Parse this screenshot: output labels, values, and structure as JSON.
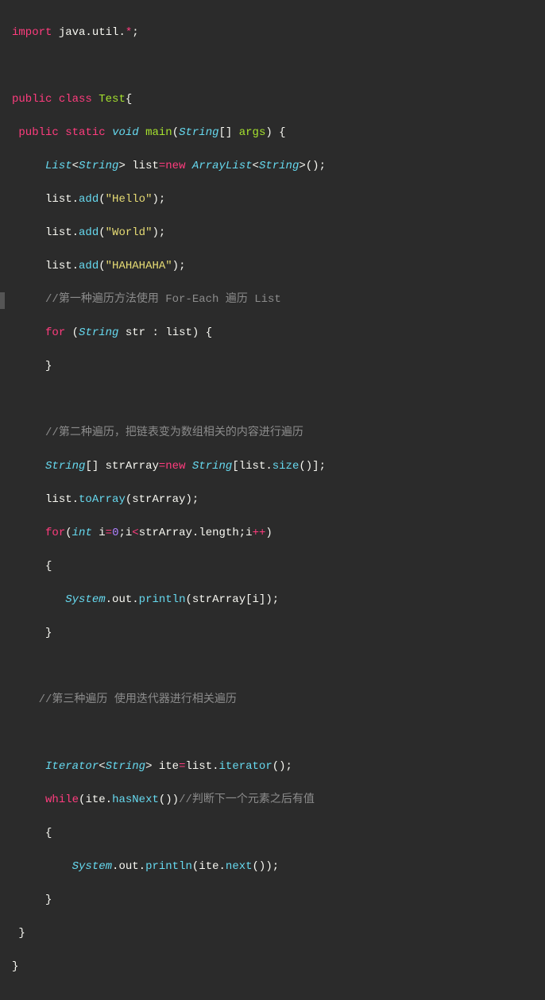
{
  "code": {
    "l1_import": "import",
    "l1_pkg": "java.util.",
    "l1_star": "*",
    "l1_semi": ";",
    "l2_public": "public",
    "l2_class": "class",
    "l2_name": "Test",
    "l2_brace": "{",
    "l3_public": "public",
    "l3_static": "static",
    "l3_void": "void",
    "l3_main": "main",
    "l3_paren1": "(",
    "l3_type": "String",
    "l3_brackets": "[] ",
    "l3_args": "args",
    "l3_paren2": ") {",
    "l4_type": "List",
    "l4_lt": "<",
    "l4_generic": "String",
    "l4_gt": "> ",
    "l4_var": "list",
    "l4_eq": "=",
    "l4_new": "new",
    "l4_arraylist": "ArrayList",
    "l4_lt2": "<",
    "l4_generic2": "String",
    "l4_gt2": ">();",
    "l5_var": "list",
    "l5_dot": ".",
    "l5_add": "add",
    "l5_str": "\"Hello\"",
    "l5_end": ");",
    "l5_paren": "(",
    "l6_var": "list",
    "l6_dot": ".",
    "l6_add": "add",
    "l6_paren": "(",
    "l6_str": "\"World\"",
    "l6_end": ");",
    "l7_var": "list",
    "l7_dot": ".",
    "l7_add": "add",
    "l7_paren": "(",
    "l7_str": "\"HAHAHAHA\"",
    "l7_end": ");",
    "l8_comment": "//第一种遍历方法使用 For-Each 遍历 List",
    "l9_for": "for",
    "l9_paren1": " (",
    "l9_type": "String",
    "l9_var": "str",
    "l9_colon": " : ",
    "l9_list": "list",
    "l9_paren2": ") {",
    "l10_brace": "}",
    "l11_comment": "//第二种遍历，把链表变为数组相关的内容进行遍历",
    "l12_type": "String",
    "l12_brackets": "[] ",
    "l12_var": "strArray",
    "l12_eq": "=",
    "l12_new": "new",
    "l12_type2": "String",
    "l12_bracket1": "[",
    "l12_list": "list",
    "l12_dot": ".",
    "l12_size": "size",
    "l12_end": "()];",
    "l13_var": "list",
    "l13_dot": ".",
    "l13_method": "toArray",
    "l13_paren": "(",
    "l13_arg": "strArray",
    "l13_end": ");",
    "l14_for": "for",
    "l14_paren": "(",
    "l14_int": "int",
    "l14_var": "i",
    "l14_eq": "=",
    "l14_zero": "0",
    "l14_semi1": ";",
    "l14_i": "i",
    "l14_lt": "<",
    "l14_arr": "strArray",
    "l14_dot": ".",
    "l14_length": "length",
    "l14_semi2": ";",
    "l14_i2": "i",
    "l14_inc": "++",
    "l14_paren2": ")",
    "l15_brace": "{",
    "l16_sys": "System",
    "l16_dot1": ".",
    "l16_out": "out",
    "l16_dot2": ".",
    "l16_println": "println",
    "l16_paren": "(",
    "l16_arr": "strArray",
    "l16_bracket1": "[",
    "l16_i": "i",
    "l16_bracket2": "]);",
    "l17_brace": "}",
    "l18_comment": "//第三种遍历 使用迭代器进行相关遍历",
    "l19_type": "Iterator",
    "l19_lt": "<",
    "l19_generic": "String",
    "l19_gt": "> ",
    "l19_var": "ite",
    "l19_eq": "=",
    "l19_list": "list",
    "l19_dot": ".",
    "l19_method": "iterator",
    "l19_end": "();",
    "l20_while": "while",
    "l20_paren": "(",
    "l20_ite": "ite",
    "l20_dot": ".",
    "l20_method": "hasNext",
    "l20_paren2": "())",
    "l20_comment": "//判断下一个元素之后有值",
    "l21_brace": "{",
    "l22_sys": "System",
    "l22_dot1": ".",
    "l22_out": "out",
    "l22_dot2": ".",
    "l22_println": "println",
    "l22_paren": "(",
    "l22_ite": "ite",
    "l22_dot3": ".",
    "l22_next": "next",
    "l22_end": "());",
    "l23_brace": "}",
    "l24_brace": " }",
    "l25_brace": "}"
  }
}
